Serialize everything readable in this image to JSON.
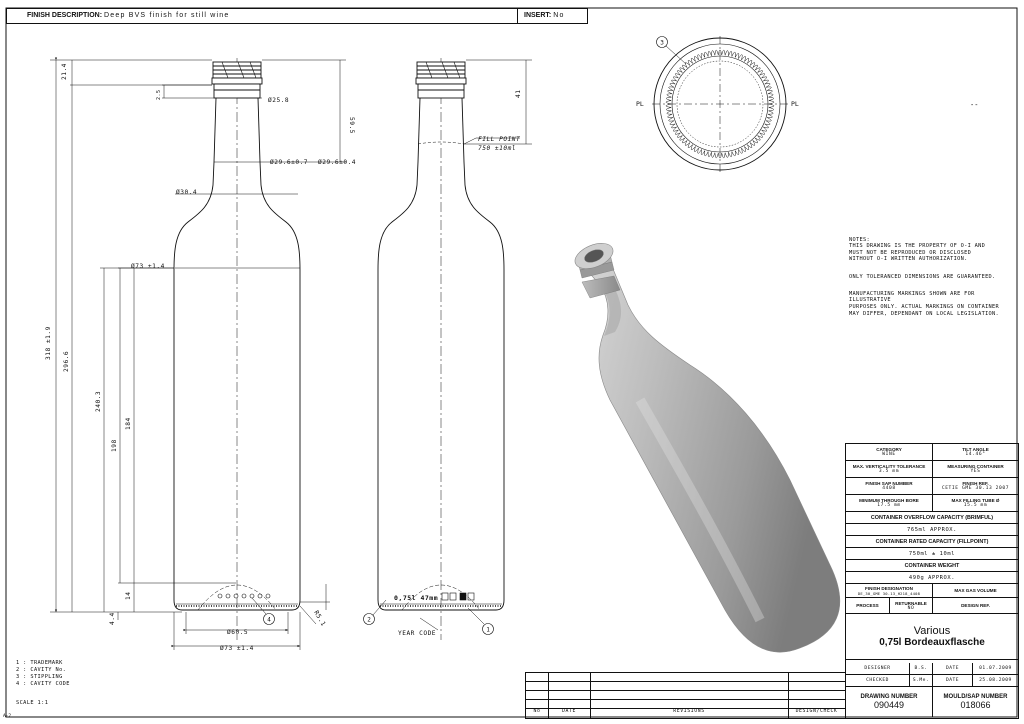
{
  "header": {
    "finish_label": "FINISH DESCRIPTION:",
    "finish_value": "Deep BVS finish for still wine",
    "insert_label": "INSERT:",
    "insert_value": "No"
  },
  "dims": {
    "d1": "21.4",
    "d2": "59.5",
    "d3": "2.5",
    "d4": "Ø25.8",
    "d5": "Ø29.6±0.7",
    "d6": "Ø29.6±0.4",
    "d7": "Ø30.4",
    "d8": "Ø73 ±1.4",
    "d9": "318 ±1.9",
    "d10": "296.6",
    "d11": "240.3",
    "d12": "198",
    "d13": "184",
    "d14": "14",
    "d15": "4.4",
    "d16": "Ø60.5",
    "d17": "Ø73 ±1.4",
    "d18": "R5.1",
    "side_41": "41",
    "fill_point": "FILL POINT",
    "fill_value": "750 ±10ml",
    "year_code": "YEAR CODE",
    "emboss": "0,75l  47mm",
    "pl_left": "PL",
    "pl_right": "PL",
    "dash": "--"
  },
  "callouts": [
    "1",
    "2",
    "3",
    "4"
  ],
  "notes": [
    "NOTES:\nTHIS DRAWING IS THE PROPERTY OF O-I AND\nMUST NOT BE REPRODUCED OR DISCLOSED\nWITHOUT O-I WRITTEN AUTHORIZATION.",
    "ONLY TOLERANCED DIMENSIONS ARE GUARANTEED.",
    "MANUFACTURING MARKINGS SHOWN ARE FOR ILLUSTRATIVE\nPURPOSES ONLY. ACTUAL MARKINGS ON CONTAINER\nMAY DIFFER, DEPENDANT ON LOCAL LEGISLATION."
  ],
  "legend": [
    "1 : TRADEMARK",
    "2 : CAVITY No.",
    "3 : STIPPLING",
    "4 : CAVITY CODE"
  ],
  "scale": "SCALE 1:1",
  "corner_mark": "A-2",
  "title_block": {
    "category_label": "CATEGORY",
    "category_value": "WINE",
    "tilt_label": "TILT ANGLE",
    "tilt_value": "14.46°",
    "vert_label": "MAX. VERTICALITY TOLERANCE",
    "vert_value": "3.5 mm",
    "measuring_label": "MEASURING CONTAINER",
    "measuring_value": "YES",
    "sap_label": "FINISH SAP NUMBER",
    "sap_value": "4408",
    "finish_ref_label": "FINISH REF.",
    "finish_ref_value": "CETIE GME 30.13 2007",
    "bore_label": "MINIMUM THROUGH BORE",
    "bore_value": "17.5 mm",
    "tube_label": "MAX FILLING TUBE Ø",
    "tube_value": "15.5 mm",
    "overflow_label": "CONTAINER OVERFLOW CAPACITY (BRIMFUL)",
    "overflow_value": "765ml APPROX.",
    "rated_label": "CONTAINER RATED CAPACITY (FILLPOINT)",
    "rated_value": "750ml ± 10ml",
    "weight_label": "CONTAINER WEIGHT",
    "weight_value": "490g APPROX.",
    "designation_label": "FINISH DESIGNATION",
    "designation_value": "DE_30_GME 30.13_H218_4408",
    "gas_label": "MAX GAS VOLUME",
    "process_label": "PROCESS",
    "returnable_label": "RETURNABLE",
    "returnable_value": "NO",
    "design_ref_label": "DESIGN REF.",
    "title_line1": "Various",
    "title_line2": "0,75l Bordeauxflasche",
    "designer_label": "DESIGNER",
    "designer_value": "B.S.",
    "date_label1": "DATE",
    "date_value1": "01.07.2009",
    "checked_label": "CHECKED",
    "checked_value": "S.Me.",
    "date_label2": "DATE",
    "date_value2": "25.08.2009",
    "drawing_number_label": "DRAWING NUMBER",
    "drawing_number_value": "090449",
    "mould_label": "MOULD/SAP NUMBER",
    "mould_value": "018066"
  },
  "revision_table": {
    "no": "No",
    "date": "DATE",
    "revisions": "REVISIONS",
    "design_check": "DESIGN/CHECK"
  }
}
